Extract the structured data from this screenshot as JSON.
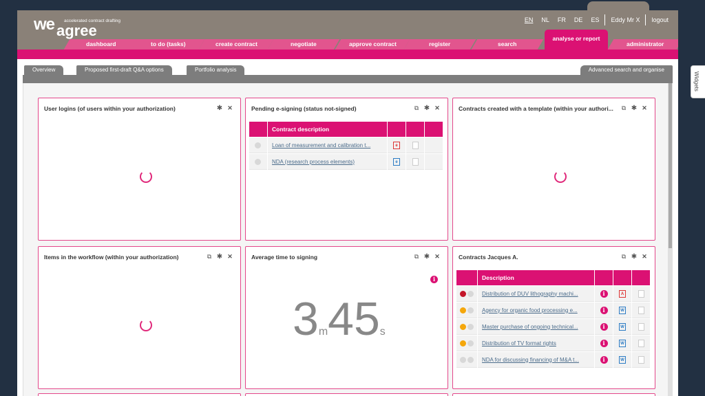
{
  "logo": {
    "we": "we",
    "agree": "agree",
    "tagline": "accelerated contract drafting"
  },
  "languages": [
    "EN",
    "NL",
    "FR",
    "DE",
    "ES"
  ],
  "active_language": "EN",
  "user": "Eddy Mr X",
  "logout_label": "logout",
  "nav": {
    "dashboard": "dashboard",
    "todo": "to do (tasks)",
    "create": "create contract",
    "negotiate": "negotiate",
    "approve": "approve contract",
    "register": "register",
    "search": "search",
    "analyse": "analyse or report",
    "admin": "administrator"
  },
  "subtabs": {
    "overview": "Overview",
    "qa": "Proposed first-draft Q&A options",
    "portfolio": "Portfolio analysis",
    "advanced": "Advanced search and organise"
  },
  "side_tab": "Widgets",
  "widgets": {
    "user_logins": {
      "title": "User logins (of users within your authorization)"
    },
    "pending": {
      "title": "Pending e-signing (status not-signed)",
      "col_header": "Contract description",
      "rows": [
        {
          "desc": "Loan of measurement and calibration t...",
          "file": "pdf"
        },
        {
          "desc": "NDA (research process elements)",
          "file": "doc"
        }
      ]
    },
    "template": {
      "title": "Contracts created with a template (within your authori..."
    },
    "workflow": {
      "title": "Items in the workflow (within your authorization)"
    },
    "avg_time": {
      "title": "Average time to signing",
      "major": "3",
      "major_unit": "m",
      "minor": "45",
      "minor_unit": "s"
    },
    "jacques": {
      "title": "Contracts Jacques A.",
      "col_header": "Description",
      "rows": [
        {
          "desc": "Distribution of DUV lithography machi...",
          "status": "red",
          "file": "pdf"
        },
        {
          "desc": "Agency for organic food processing e...",
          "status": "orange",
          "file": "doc"
        },
        {
          "desc": "Master purchase of ongoing technical...",
          "status": "orange",
          "file": "doc"
        },
        {
          "desc": "Distribution of TV format rights",
          "status": "orange",
          "file": "doc"
        },
        {
          "desc": "NDA for discussing financing of M&A t...",
          "status": "grey",
          "file": "doc"
        }
      ]
    }
  },
  "colors": {
    "brand": "#db1173",
    "header": "#8a8178",
    "background": "#223042"
  }
}
